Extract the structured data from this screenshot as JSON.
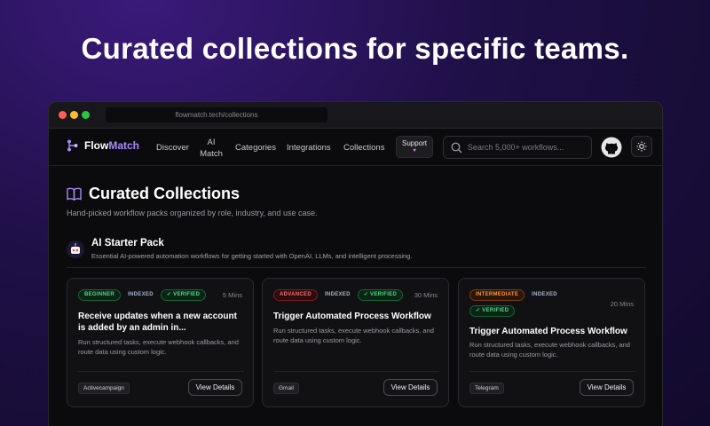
{
  "headline": "Curated collections for specific teams.",
  "browser": {
    "url": "flowmatch.tech/collections"
  },
  "nav": {
    "brand_prefix": "Flow",
    "brand_suffix": "Match",
    "items": [
      {
        "label": "Discover"
      },
      {
        "label": "AI Match"
      },
      {
        "label": "Categories"
      },
      {
        "label": "Integrations"
      },
      {
        "label": "Collections"
      }
    ],
    "support_label": "Support",
    "support_icon": "heart-icon",
    "search_placeholder": "Search 5,000+ workflows..."
  },
  "page": {
    "title": "Curated Collections",
    "subtitle": "Hand-picked workflow packs organized by role, industry, and use case."
  },
  "pack": {
    "title": "AI Starter Pack",
    "description": "Essential AI-powered automation workflows for getting started with OpenAI, LLMs, and intelligent processing."
  },
  "colors": {
    "accent": "#a78bfa",
    "beginner": "#4ade80",
    "advanced": "#f87171",
    "intermediate": "#fb923c"
  },
  "cards": [
    {
      "level": "BEGINNER",
      "indexed": "INDEXED",
      "verified": "VERIFIED",
      "mins": "5 Mins",
      "title": "Receive updates when a new account is added by an admin in...",
      "description": "Run structured tasks, execute webhook callbacks, and route data using custom logic.",
      "tag": "Activecampaign",
      "button": "View Details"
    },
    {
      "level": "ADVANCED",
      "indexed": "INDEXED",
      "verified": "VERIFIED",
      "mins": "30 Mins",
      "title": "Trigger Automated Process Workflow",
      "description": "Run structured tasks, execute webhook callbacks, and route data using custom logic.",
      "tag": "Gmail",
      "button": "View Details"
    },
    {
      "level": "INTERMEDIATE",
      "indexed": "INDEXED",
      "verified": "VERIFIED",
      "mins": "20 Mins",
      "title": "Trigger Automated Process Workflow",
      "description": "Run structured tasks, execute webhook callbacks, and route data using custom logic.",
      "tag": "Telegram",
      "button": "View Details"
    }
  ]
}
